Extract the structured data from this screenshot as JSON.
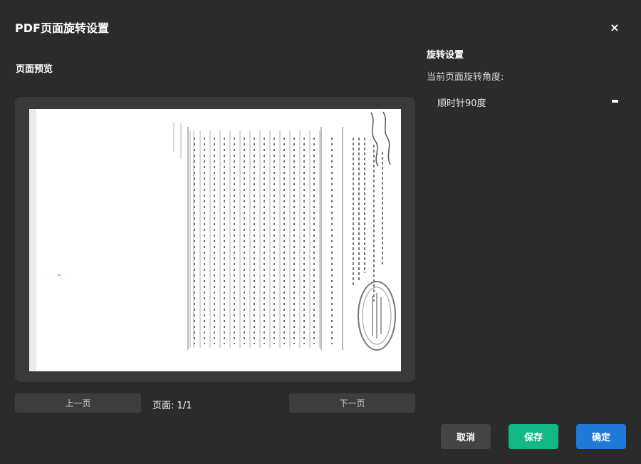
{
  "dialog": {
    "title": "PDF页面旋转设置",
    "close_icon": "close-icon",
    "close_glyph": "×"
  },
  "preview": {
    "label": "页面预览",
    "prev_label": "上一页",
    "next_label": "下一页",
    "page_indicator": "页面: 1/1"
  },
  "rotation": {
    "heading": "旋转设置",
    "angle_label": "当前页面旋转角度:",
    "selected_angle": "顺时针90度"
  },
  "actions": {
    "cancel_label": "取消",
    "save_label": "保存",
    "ok_label": "确定"
  },
  "colors": {
    "background": "#2b2b2b",
    "save": "#12b886",
    "ok": "#1e7ad6",
    "cancel": "#444444"
  }
}
